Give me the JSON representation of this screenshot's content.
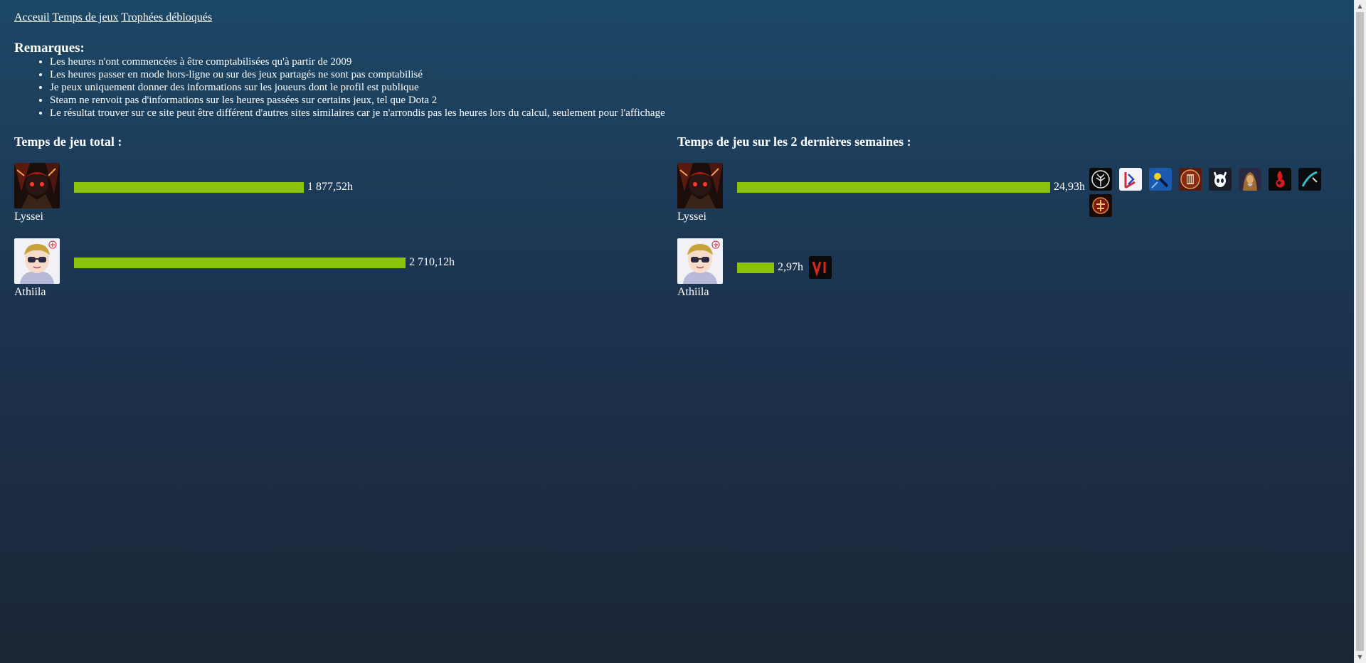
{
  "nav": {
    "home": "Acceuil",
    "playtime": "Temps de jeux",
    "trophies": "Trophées débloqués"
  },
  "remarks": {
    "title": "Remarques:",
    "items": [
      "Les heures n'ont commencées à être comptabilisées qu'à partir de 2009",
      "Les heures passer en mode hors-ligne ou sur des jeux partagés ne sont pas comptabilisé",
      "Je peux uniquement donner des informations sur les joueurs dont le profil est publique",
      "Steam ne renvoit pas d'informations sur les heures passées sur certains jeux, tel que Dota 2",
      "Le résultat trouver sur ce site peut être différent d'autres sites similaires car je n'arrondis pas les heures lors du calcul, seulement pour l'affichage"
    ]
  },
  "total": {
    "title": "Temps de jeu total :",
    "players": [
      {
        "name": "Lyssei",
        "value": "1 877,52h",
        "hours": 1877.52
      },
      {
        "name": "Athiila",
        "value": "2 710,12h",
        "hours": 2710.12
      }
    ]
  },
  "recent": {
    "title": "Temps de jeu sur les 2 dernières semaines :",
    "players": [
      {
        "name": "Lyssei",
        "value": "24,93h",
        "hours": 24.93,
        "games": [
          "white-tree-emblem-icon",
          "card-game-icon",
          "blue-tool-icon",
          "knight-crest-icon",
          "hollow-knight-icon",
          "hooded-figure-icon",
          "red-flame-icon",
          "teal-slash-icon",
          "ornate-crest-icon"
        ]
      },
      {
        "name": "Athiila",
        "value": "2,97h",
        "hours": 2.97,
        "games": [
          "roman-six-icon"
        ]
      }
    ]
  },
  "colors": {
    "bar": "#8bc30a",
    "background_top": "#1c4866",
    "background_bottom": "#1b2535"
  }
}
